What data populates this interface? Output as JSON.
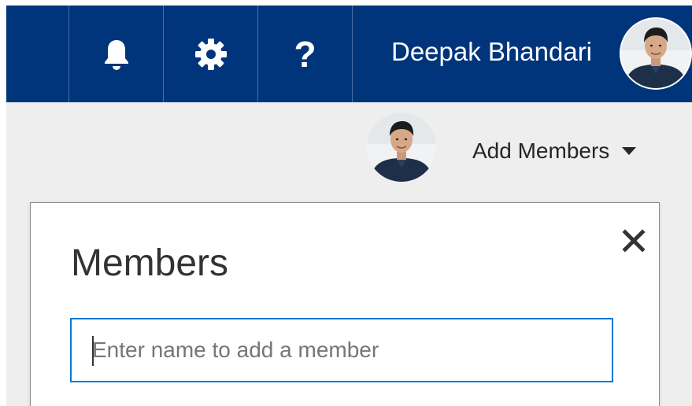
{
  "topbar": {
    "background": "#00357b",
    "notifications_icon": "bell-icon",
    "settings_icon": "gear-icon",
    "help_icon": "question-icon",
    "help_glyph": "?",
    "user_name": "Deepak Bhandari"
  },
  "group_header": {
    "add_members_label": "Add Members",
    "dropdown_icon": "caret-down-icon"
  },
  "members_panel": {
    "title": "Members",
    "close_icon": "close-icon",
    "search_placeholder": "Enter name to add a member",
    "search_value": "",
    "accent_color": "#0078d7"
  }
}
